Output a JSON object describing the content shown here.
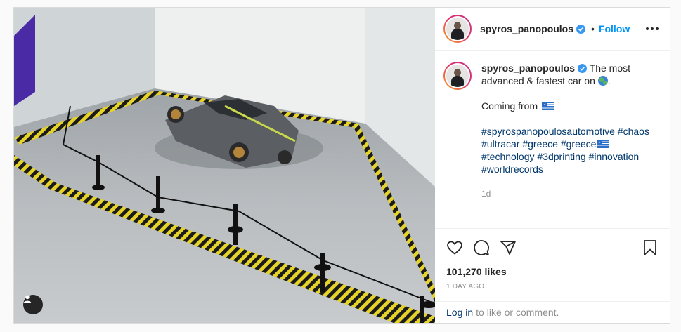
{
  "post": {
    "username": "spyros_panopoulos",
    "follow_label": "Follow",
    "separator": "•",
    "caption": {
      "line1": "The most advanced & fastest car on",
      "line1_end": ".",
      "line2": "Coming from",
      "hashtags": [
        "#spyrospanopoulosautomotive",
        "#chaos",
        "#ultracar",
        "#greece",
        "#greece",
        "#technology",
        "#3dprinting",
        "#innovation",
        "#worldrecords"
      ]
    },
    "relative_time": "1d",
    "likes": "101,270 likes",
    "date": "1 DAY AGO",
    "login": {
      "link_label": "Log in",
      "rest_text": "to like or comment."
    }
  },
  "icons": {
    "verified": "verified-badge-icon",
    "more": "more-options-icon",
    "like": "heart-icon",
    "comment": "comment-icon",
    "share": "share-icon",
    "save": "bookmark-icon",
    "user_tag": "user-tag-icon"
  },
  "colors": {
    "accent": "#0095f6",
    "hashtag": "#00376b",
    "muted": "#8e8e8e",
    "verified": "#3897f0"
  }
}
